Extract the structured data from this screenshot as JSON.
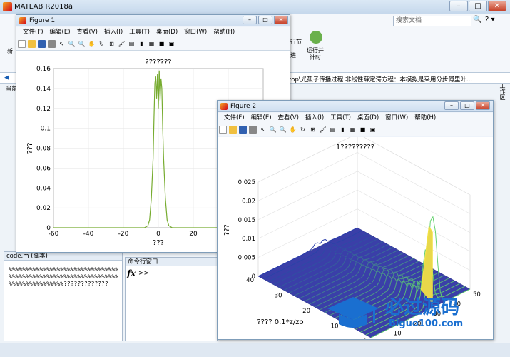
{
  "app": {
    "title": "MATLAB R2018a",
    "search_placeholder": "搜索文档",
    "run_section_label": "行节",
    "run_time_label": "运行并\n计时",
    "left_label": "新",
    "current_label": "当前",
    "path_text": "ktop\\光孤子传播过程 非线性薛定谔方程：本模拟是采用分步傅里叶...",
    "side_tab": "工作区"
  },
  "editor": {
    "tab": "code.m",
    "tab_suffix": "(脚本)",
    "text": "%%%%%%%%%%%%%%%%%%%%%%%%%%%%%%%%%%%%%%%%%%%%%%%%%%%%%%%%%%%%%%%%%%%%%%%%%%%%%%%%?????????????"
  },
  "command": {
    "title": "命令行窗口",
    "fx": "fx",
    "prompt": ">>"
  },
  "menu": [
    "文件(F)",
    "编辑(E)",
    "查看(V)",
    "插入(I)",
    "工具(T)",
    "桌面(D)",
    "窗口(W)",
    "帮助(H)"
  ],
  "figure1": {
    "title": "Figure 1"
  },
  "figure2": {
    "title": "Figure 2"
  },
  "chart_data": [
    {
      "type": "line",
      "title": "???????",
      "xlabel": "???",
      "ylabel": "???",
      "xlim": [
        -60,
        60
      ],
      "ylim": [
        0,
        0.16
      ],
      "xticks": [
        -60,
        -40,
        -20,
        0,
        20
      ],
      "yticks": [
        0,
        0.02,
        0.04,
        0.06,
        0.08,
        0.1,
        0.12,
        0.14,
        0.16
      ],
      "grid": true,
      "series": [
        {
          "color": "#77ac30",
          "x": [
            -60,
            -8,
            -6,
            -5,
            -4,
            -3,
            -2.5,
            -2,
            -1.5,
            -1,
            -0.5,
            0,
            0.5,
            1,
            1.5,
            2,
            2.5,
            3,
            4,
            5,
            6,
            8,
            60
          ],
          "y": [
            0,
            0,
            0.002,
            0.008,
            0.03,
            0.07,
            0.11,
            0.145,
            0.152,
            0.13,
            0.155,
            0.12,
            0.158,
            0.128,
            0.15,
            0.14,
            0.1,
            0.07,
            0.03,
            0.008,
            0.002,
            0,
            0
          ]
        }
      ]
    },
    {
      "type": "surface",
      "title": "1?????????",
      "xlabel": "????  0.1*z/zo",
      "ylabel": "???",
      "zlim": [
        0,
        0.025
      ],
      "zticks": [
        0,
        0.005,
        0.01,
        0.015,
        0.02,
        0.025
      ],
      "xticks": [
        0,
        10,
        20,
        30,
        40
      ],
      "yticks": [
        0,
        10,
        20,
        30,
        40,
        50
      ]
    }
  ],
  "watermark": {
    "text": "必过源码",
    "url": "Biguo100.com"
  }
}
